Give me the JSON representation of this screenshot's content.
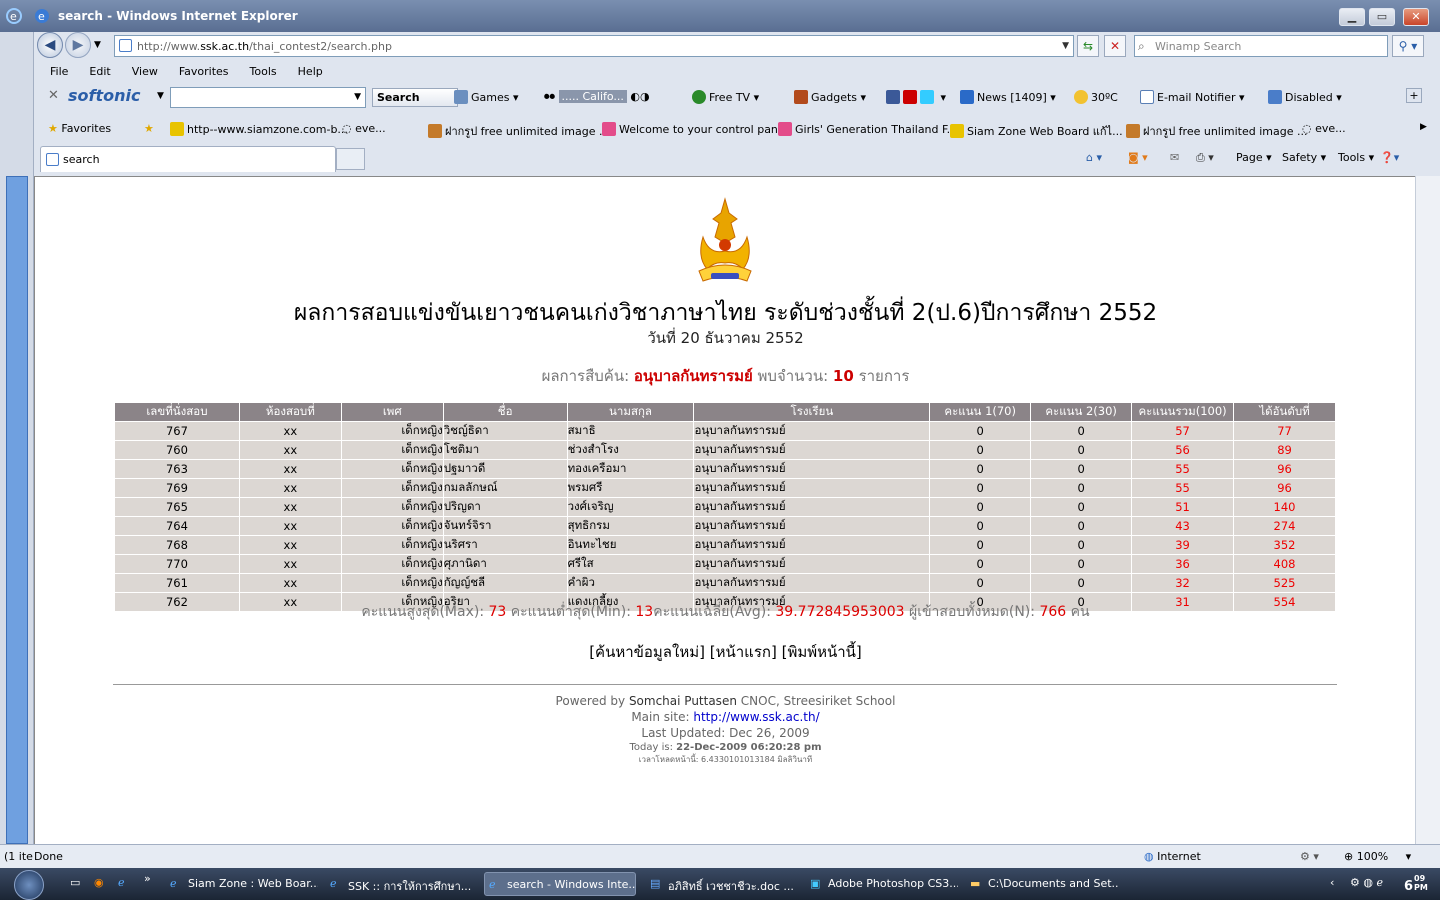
{
  "window": {
    "title": "search - Windows Internet Explorer",
    "controls": [
      "▁",
      "▭",
      "✕"
    ]
  },
  "address": {
    "url_prefix": "http://www.",
    "url_host": "ssk.ac.th",
    "url_path": "/thai_contest2/search.php",
    "search_placeholder": "Winamp Search"
  },
  "menu": [
    "File",
    "Edit",
    "View",
    "Favorites",
    "Tools",
    "Help"
  ],
  "toolbar": {
    "brand": "softonic",
    "search_button": "Search",
    "games": "Games",
    "media": "..... Califo...",
    "free_tv": "Free TV",
    "gadgets": "Gadgets",
    "news": "News [1409]",
    "weather": "30ºC",
    "email": "E-mail Notifier",
    "disabled": "Disabled"
  },
  "favorites": {
    "label": "Favorites",
    "items": [
      "http--www.siamzone.com-b...",
      "eve...",
      "ฝากรูป free unlimited image ...",
      "Welcome to your control panel",
      "Girls' Generation Thailand F...",
      "Siam Zone  Web Board  แก้ไ...",
      "ฝากรูป free unlimited image ...",
      "eve..."
    ]
  },
  "tab": {
    "title": "search"
  },
  "commands": [
    "Page ▾",
    "Safety ▾",
    "Tools ▾"
  ],
  "page": {
    "title": "ผลการสอบแข่งขันเยาวชนคนเก่งวิชาภาษาไทย ระดับช่วงชั้นที่ 2(ป.6)ปีการศึกษา 2552",
    "date": "วันที่ 20 ธันวาคม 2552",
    "result_label": "ผลการสืบค้น:",
    "result_school": "อนุบาลกันทรารมย์",
    "result_found": "พบจำนวน:",
    "result_count": "10",
    "result_unit": "รายการ",
    "columns": [
      "เลขที่นั่งสอบ",
      "ห้องสอบที่",
      "เพศ",
      "ชื่อ",
      "นามสกุล",
      "โรงเรียน",
      "คะแนน 1(70)",
      "คะแนน 2(30)",
      "คะแนนรวม(100)",
      "ได้อันดับที่"
    ],
    "rows": [
      [
        "767",
        "xx",
        "เด็กหญิง",
        "วิชญ์ธิดา",
        "สมาธิ",
        "อนุบาลกันทรารมย์",
        "0",
        "0",
        "57",
        "77"
      ],
      [
        "760",
        "xx",
        "เด็กหญิง",
        "โชติมา",
        "ช่วงสำโรง",
        "อนุบาลกันทรารมย์",
        "0",
        "0",
        "56",
        "89"
      ],
      [
        "763",
        "xx",
        "เด็กหญิง",
        "ปฐมาวดี",
        "ทองเครือมา",
        "อนุบาลกันทรารมย์",
        "0",
        "0",
        "55",
        "96"
      ],
      [
        "769",
        "xx",
        "เด็กหญิง",
        "กมลลักษณ์",
        "พรมศรี",
        "อนุบาลกันทรารมย์",
        "0",
        "0",
        "55",
        "96"
      ],
      [
        "765",
        "xx",
        "เด็กหญิง",
        "ปริญดา",
        "วงศ์เจริญ",
        "อนุบาลกันทรารมย์",
        "0",
        "0",
        "51",
        "140"
      ],
      [
        "764",
        "xx",
        "เด็กหญิง",
        "จันทร์จิรา",
        "สุทธิกรม",
        "อนุบาลกันทรารมย์",
        "0",
        "0",
        "43",
        "274"
      ],
      [
        "768",
        "xx",
        "เด็กหญิง",
        "นริศรา",
        "อินทะไชย",
        "อนุบาลกันทรารมย์",
        "0",
        "0",
        "39",
        "352"
      ],
      [
        "770",
        "xx",
        "เด็กหญิง",
        "ศุภานิดา",
        "ศรีใส",
        "อนุบาลกันทรารมย์",
        "0",
        "0",
        "36",
        "408"
      ],
      [
        "761",
        "xx",
        "เด็กหญิง",
        "กัญญ์ชลี",
        "คำผิว",
        "อนุบาลกันทรารมย์",
        "0",
        "0",
        "32",
        "525"
      ],
      [
        "762",
        "xx",
        "เด็กหญิง",
        "อริยา",
        "แดงเกลี้ยง",
        "อนุบาลกันทรารมย์",
        "0",
        "0",
        "31",
        "554"
      ]
    ],
    "stats": {
      "max_label": "คะแนนสูงสุด(Max):",
      "max": "73",
      "min_label": "คะแนนต่ำสุด(Min):",
      "min": "13",
      "avg_label": "คะแนนเฉลี่ย(Avg):",
      "avg": "39.772845953003",
      "n_label": "ผู้เข้าสอบทั้งหมด(N):",
      "n": "766",
      "n_unit": "คน"
    },
    "links": [
      "[ค้นหาข้อมูลใหม่]",
      "[หน้าแรก]",
      "[พิมพ์หน้านี้]"
    ],
    "footer": {
      "powered_by": "Powered by",
      "author": "Somchai Puttasen",
      "org": "CNOC, Streesiriket School",
      "main_site_label": "Main site:",
      "main_site": "http://www.ssk.ac.th/",
      "last_updated": "Last Updated: Dec 26, 2009",
      "today_label": "Today is:",
      "today": "22-Dec-2009 06:20:28 pm",
      "load_time": "เวลาโหลดหน้านี้: 6.4330101013184 มิลลิวินาที"
    }
  },
  "status": {
    "left": "(1 ite",
    "done": "Done",
    "zone": "Internet",
    "zoom": "100%"
  },
  "taskbar": {
    "tasks": [
      "Siam Zone : Web Boar...",
      "SSK :: การให้การศึกษา...",
      "search - Windows Inte...",
      "อภิสิทธิ์ เวชชาชีวะ.doc ...",
      "Adobe Photoshop CS3...",
      "C:\\Documents and Set..."
    ],
    "clock": "6",
    "clock_suffix": "09 PM"
  }
}
